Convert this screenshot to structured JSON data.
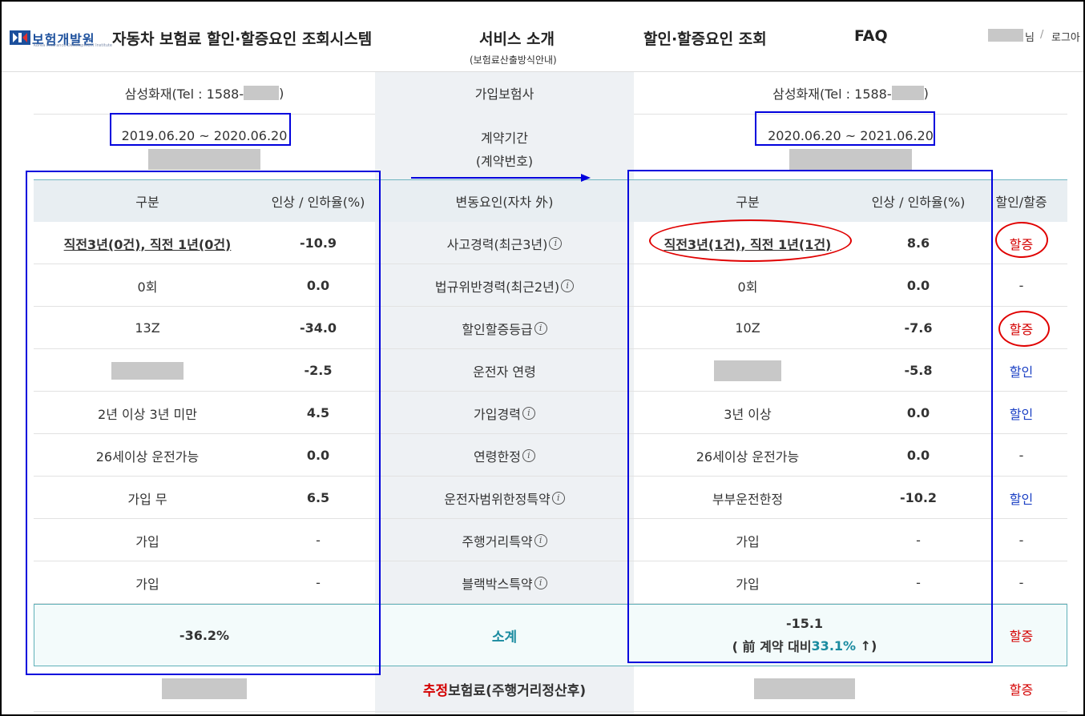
{
  "header": {
    "logo_text": "보험개발원",
    "logo_sub": "Korea Insurance Development Institute",
    "system_title": "자동차 보험료 할인·할증요인 조회시스템",
    "nav": {
      "service": "서비스 소개",
      "service_sub": "(보험료산출방식안내)",
      "lookup": "할인·할증요인 조회",
      "faq": "FAQ"
    },
    "user_suffix": "님",
    "separator": "/",
    "logout": "로그아"
  },
  "top": {
    "left_insurer": "삼성화재(Tel : 1588-",
    "left_insurer_close": ")",
    "mid_insurer_label": "가입보험사",
    "right_insurer": "삼성화재(Tel : 1588-",
    "right_insurer_close": ")",
    "left_period": "2019.06.20 ~ 2020.06.20",
    "mid_period_label": "계약기간",
    "mid_contract_label": "(계약번호)",
    "right_period": "2020.06.20 ~ 2021.06.20"
  },
  "table": {
    "headers": {
      "left_category": "구분",
      "left_rate": "인상 / 인하율(%)",
      "mid_factor": "변동요인(자차 外)",
      "right_category": "구분",
      "right_rate": "인상 / 인하율(%)",
      "right_result": "할인/할증"
    },
    "rows": [
      {
        "left_cat": "직전3년(0건), 직전 1년(0건)",
        "left_rate": "-10.9",
        "factor": "사고경력(최근3년)",
        "right_cat": "직전3년(1건), 직전 1년(1건)",
        "right_rate": "8.6",
        "result": "할증"
      },
      {
        "left_cat": "0회",
        "left_rate": "0.0",
        "factor": "법규위반경력(최근2년)",
        "right_cat": "0회",
        "right_rate": "0.0",
        "result": "-"
      },
      {
        "left_cat": "13Z",
        "left_rate": "-34.0",
        "factor": "할인할증등급",
        "right_cat": "10Z",
        "right_rate": "-7.6",
        "result": "할증"
      },
      {
        "left_cat": "",
        "left_rate": "-2.5",
        "factor": "운전자 연령",
        "right_cat": "",
        "right_rate": "-5.8",
        "result": "할인"
      },
      {
        "left_cat": "2년 이상 3년 미만",
        "left_rate": "4.5",
        "factor": "가입경력",
        "right_cat": "3년 이상",
        "right_rate": "0.0",
        "result": "할인"
      },
      {
        "left_cat": "26세이상 운전가능",
        "left_rate": "0.0",
        "factor": "연령한정",
        "right_cat": "26세이상 운전가능",
        "right_rate": "0.0",
        "result": "-"
      },
      {
        "left_cat": "가입 무",
        "left_rate": "6.5",
        "factor": "운전자범위한정특약",
        "right_cat": "부부운전한정",
        "right_rate": "-10.2",
        "result": "할인"
      },
      {
        "left_cat": "가입",
        "left_rate": "-",
        "factor": "주행거리특약",
        "right_cat": "가입",
        "right_rate": "-",
        "result": "-"
      },
      {
        "left_cat": "가입",
        "left_rate": "-",
        "factor": "블랙박스특약",
        "right_cat": "가입",
        "right_rate": "-",
        "result": "-"
      }
    ],
    "info_icon": "i",
    "subtotal": {
      "left": "-36.2%",
      "label": "소계",
      "right": "-15.1",
      "compare_prefix": "( 前 계약 대비 ",
      "compare_pct": "33.1%",
      "compare_arrow": "↑",
      "compare_suffix": " )",
      "result": "할증"
    },
    "estimate": {
      "label_red": "추정",
      "label_rest": "보험료(주행거리정산후)",
      "result": "할증"
    }
  },
  "colors": {
    "annotation_box": "#0000dd",
    "annotation_ellipse": "#e00000",
    "surcharge": "#d40000",
    "discount": "#1a3fc4",
    "highlight": "#1a8ba0"
  }
}
